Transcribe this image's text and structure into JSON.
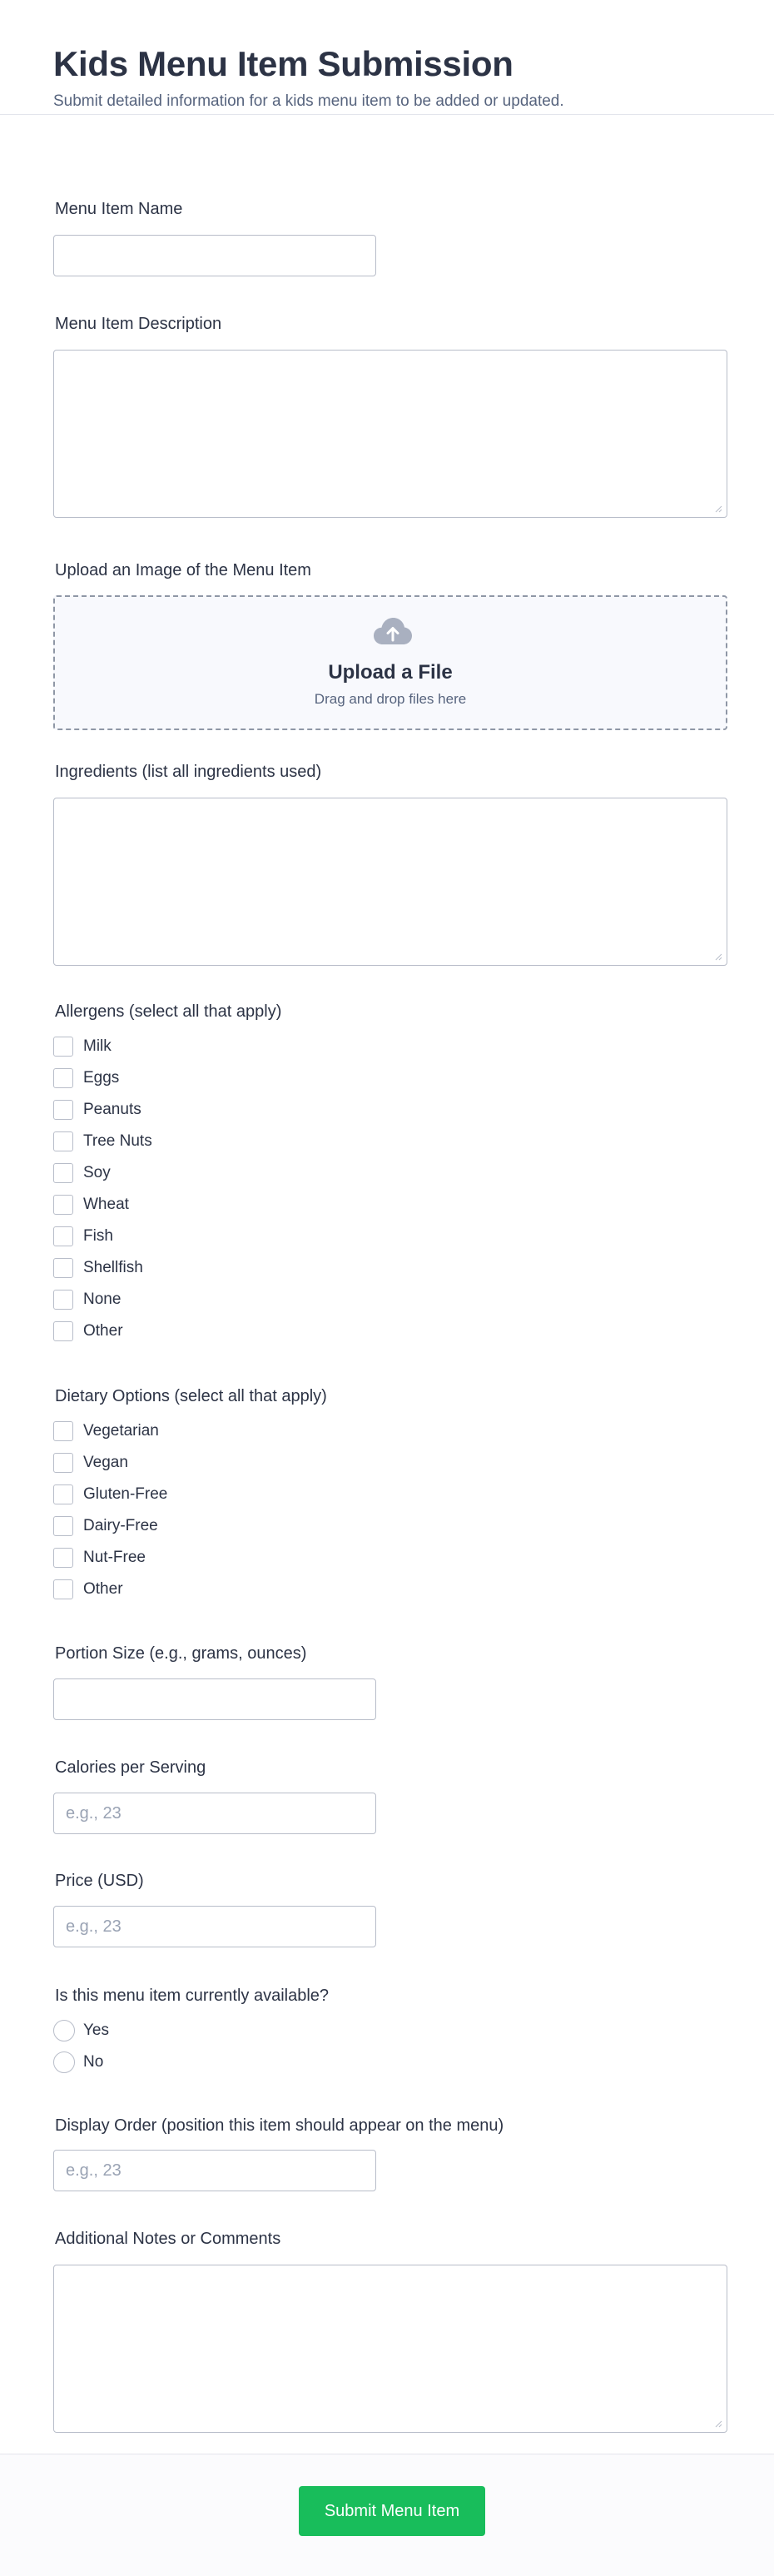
{
  "header": {
    "title": "Kids Menu Item Submission",
    "subtitle": "Submit detailed information for a kids menu item to be added or updated."
  },
  "fields": {
    "name": {
      "label": "Menu Item Name",
      "value": ""
    },
    "description": {
      "label": "Menu Item Description",
      "value": ""
    },
    "image": {
      "label": "Upload an Image of the Menu Item",
      "title": "Upload a File",
      "subtitle": "Drag and drop files here",
      "icon": "cloud-upload-icon"
    },
    "ingredients": {
      "label": "Ingredients (list all ingredients used)",
      "value": ""
    },
    "allergens": {
      "label": "Allergens (select all that apply)",
      "options": [
        "Milk",
        "Eggs",
        "Peanuts",
        "Tree Nuts",
        "Soy",
        "Wheat",
        "Fish",
        "Shellfish",
        "None",
        "Other"
      ]
    },
    "dietary": {
      "label": "Dietary Options (select all that apply)",
      "options": [
        "Vegetarian",
        "Vegan",
        "Gluten-Free",
        "Dairy-Free",
        "Nut-Free",
        "Other"
      ]
    },
    "portion": {
      "label": "Portion Size (e.g., grams, ounces)",
      "value": ""
    },
    "calories": {
      "label": "Calories per Serving",
      "placeholder": "e.g., 23"
    },
    "price": {
      "label": "Price (USD)",
      "placeholder": "e.g., 23"
    },
    "available": {
      "label": "Is this menu item currently available?",
      "options": [
        "Yes",
        "No"
      ]
    },
    "display_order": {
      "label": "Display Order (position this item should appear on the menu)",
      "placeholder": "e.g., 23"
    },
    "notes": {
      "label": "Additional Notes or Comments",
      "value": ""
    }
  },
  "footer": {
    "submit_label": "Submit Menu Item"
  },
  "colors": {
    "submit": "#18bd5b",
    "text": "#2c3345",
    "muted": "#57647e",
    "border": "#b8bdc9",
    "upload_bg": "#f8f9fd"
  }
}
